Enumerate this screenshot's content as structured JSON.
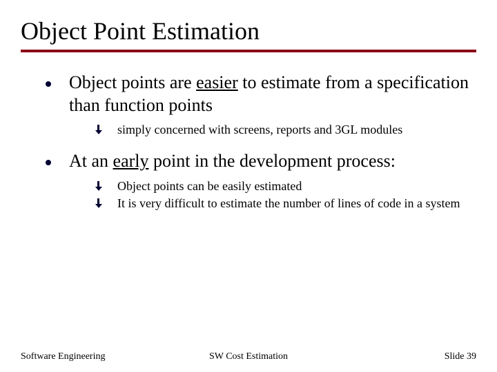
{
  "title": "Object Point Estimation",
  "bullets": {
    "b1": {
      "pre": "Object points are ",
      "u": "easier",
      "post": " to estimate from a specification than function points",
      "sub": {
        "s1": "simply concerned with screens, reports and 3GL modules"
      }
    },
    "b2": {
      "pre": "At an ",
      "u": "early",
      "post": " point in the development process:",
      "sub": {
        "s1": "Object points can be easily estimated",
        "s2": "It is very difficult to estimate the number of lines of code in a system"
      }
    }
  },
  "footer": {
    "left": "Software Engineering",
    "center": "SW Cost Estimation",
    "right": "Slide 39"
  }
}
